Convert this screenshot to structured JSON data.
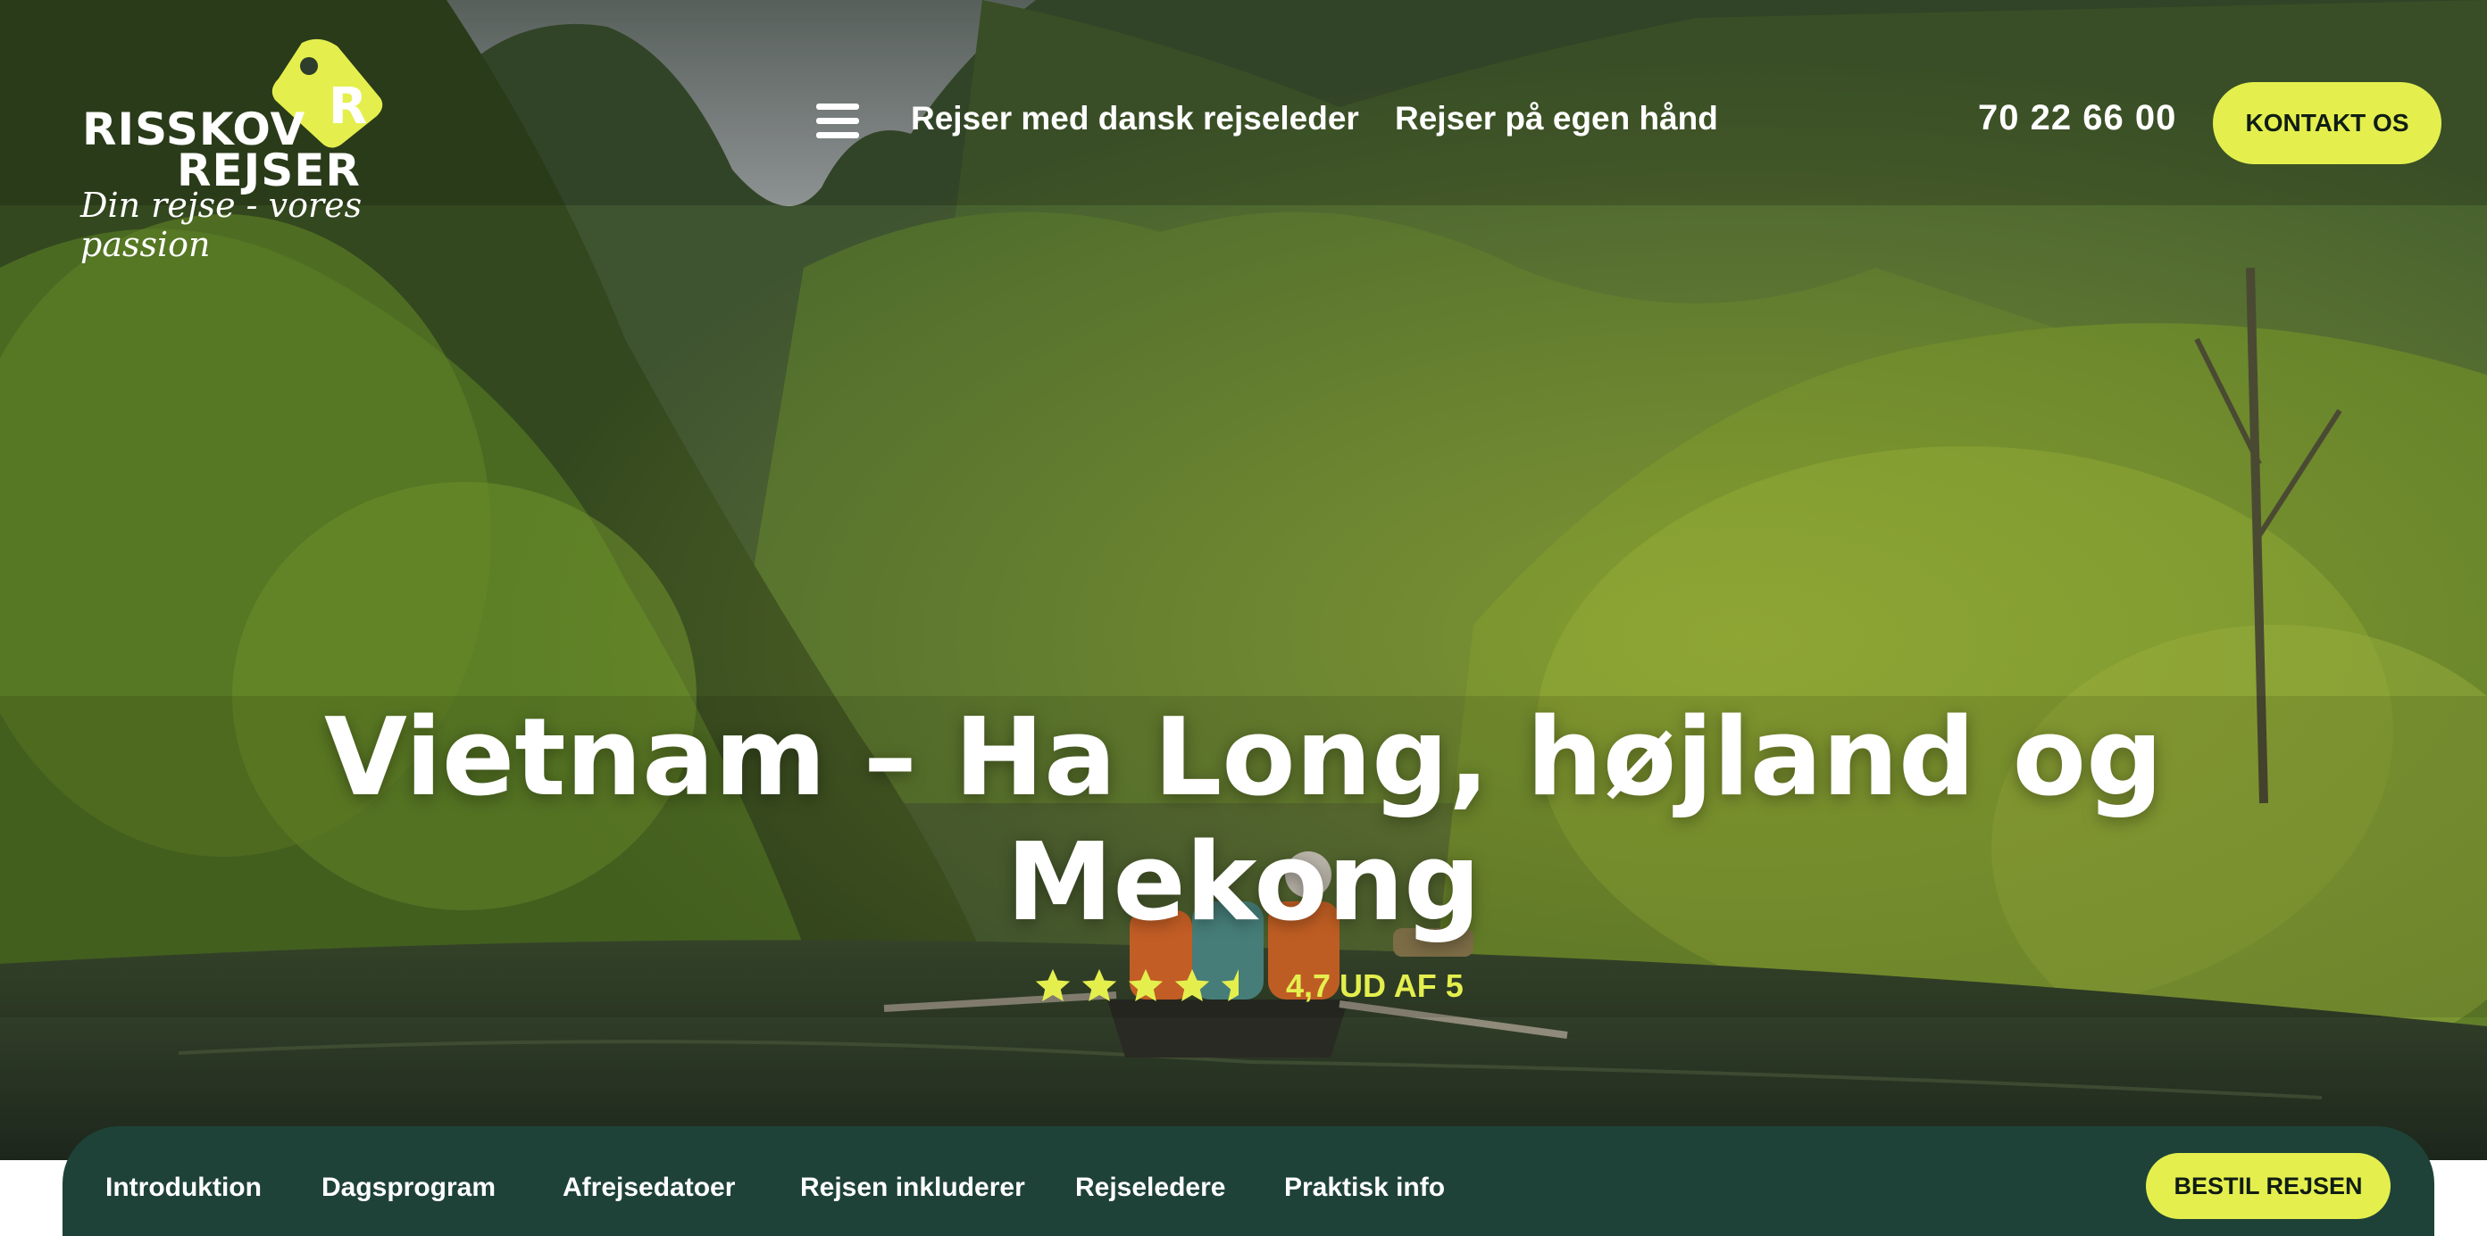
{
  "brand": {
    "name_line1": "RISSKOV",
    "name_line2": "REJSER",
    "tagline": "Din rejse - vores passion",
    "badge_letter": "R",
    "accent_color": "#e4ef4e",
    "bar_color": "#1f4238"
  },
  "header": {
    "menu_icon": "hamburger-icon",
    "nav": [
      {
        "label": "Rejser med dansk rejseleder"
      },
      {
        "label": "Rejser på egen hånd"
      }
    ],
    "phone": "70 22 66 00",
    "contact_label": "KONTAKT OS"
  },
  "hero": {
    "title_line1": "Vietnam – Ha Long, højland og",
    "title_line2": "Mekong",
    "rating": {
      "stars": 4.5,
      "max": 5,
      "text": "4,7 UD AF 5"
    }
  },
  "subnav": {
    "tabs": [
      {
        "label": "Introduktion"
      },
      {
        "label": "Dagsprogram"
      },
      {
        "label": "Afrejsedatoer"
      },
      {
        "label": "Rejsen inkluderer"
      },
      {
        "label": "Rejseledere"
      },
      {
        "label": "Praktisk info"
      }
    ],
    "book_label": "BESTIL REJSEN"
  }
}
